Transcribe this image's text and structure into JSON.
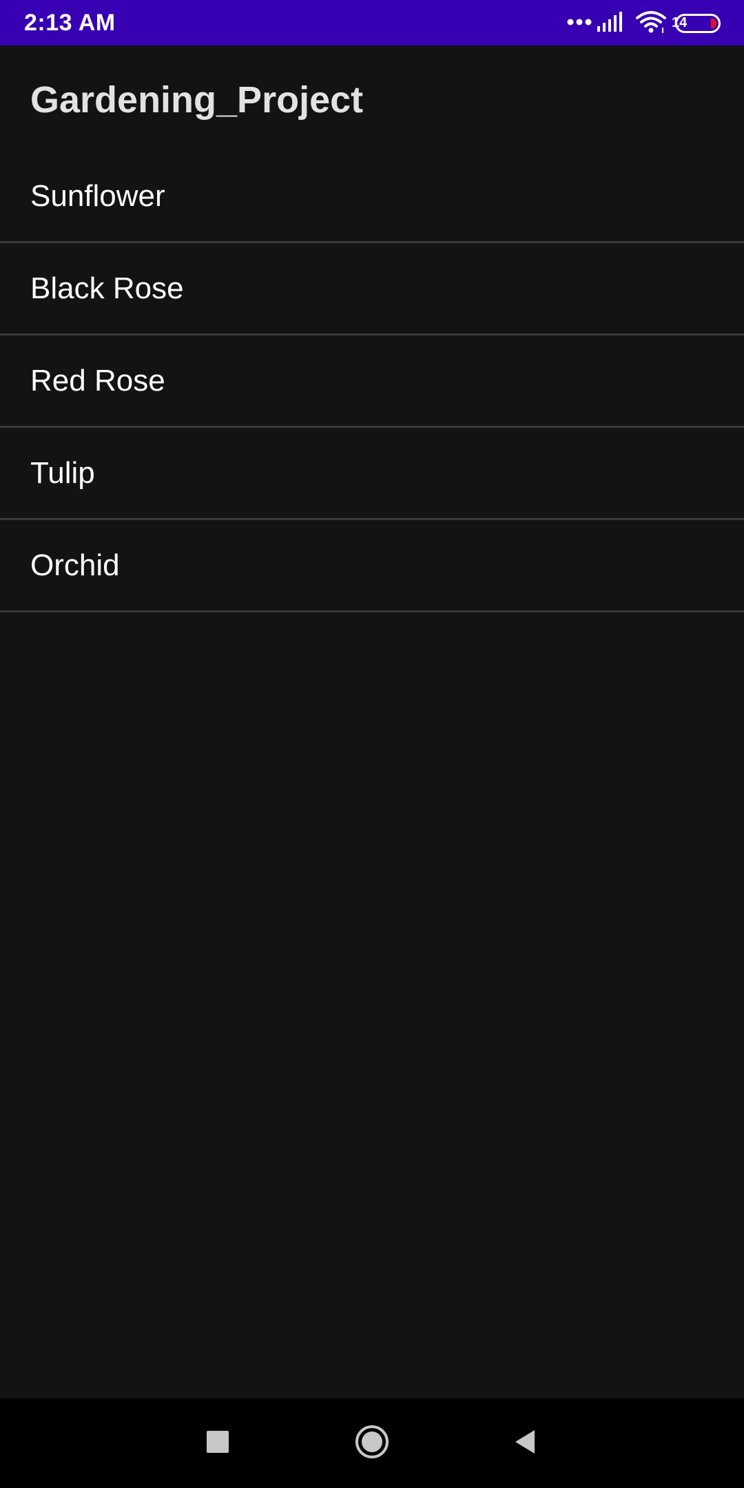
{
  "status_bar": {
    "time": "2:13 AM",
    "battery_level": "14",
    "background_color": "#3700b3",
    "icons": [
      "dots-icon",
      "signal-icon",
      "wifi-icon",
      "battery-icon"
    ]
  },
  "app_bar": {
    "title": "Gardening_Project"
  },
  "list": {
    "items": [
      {
        "label": "Sunflower"
      },
      {
        "label": "Black Rose"
      },
      {
        "label": "Red Rose"
      },
      {
        "label": "Tulip"
      },
      {
        "label": "Orchid"
      }
    ]
  },
  "nav_bar": {
    "buttons": [
      "recents-icon",
      "home-icon",
      "back-icon"
    ]
  },
  "colors": {
    "background": "#131313",
    "divider": "#3a3a3a",
    "text": "#ffffff",
    "battery_low": "#e0101a"
  }
}
